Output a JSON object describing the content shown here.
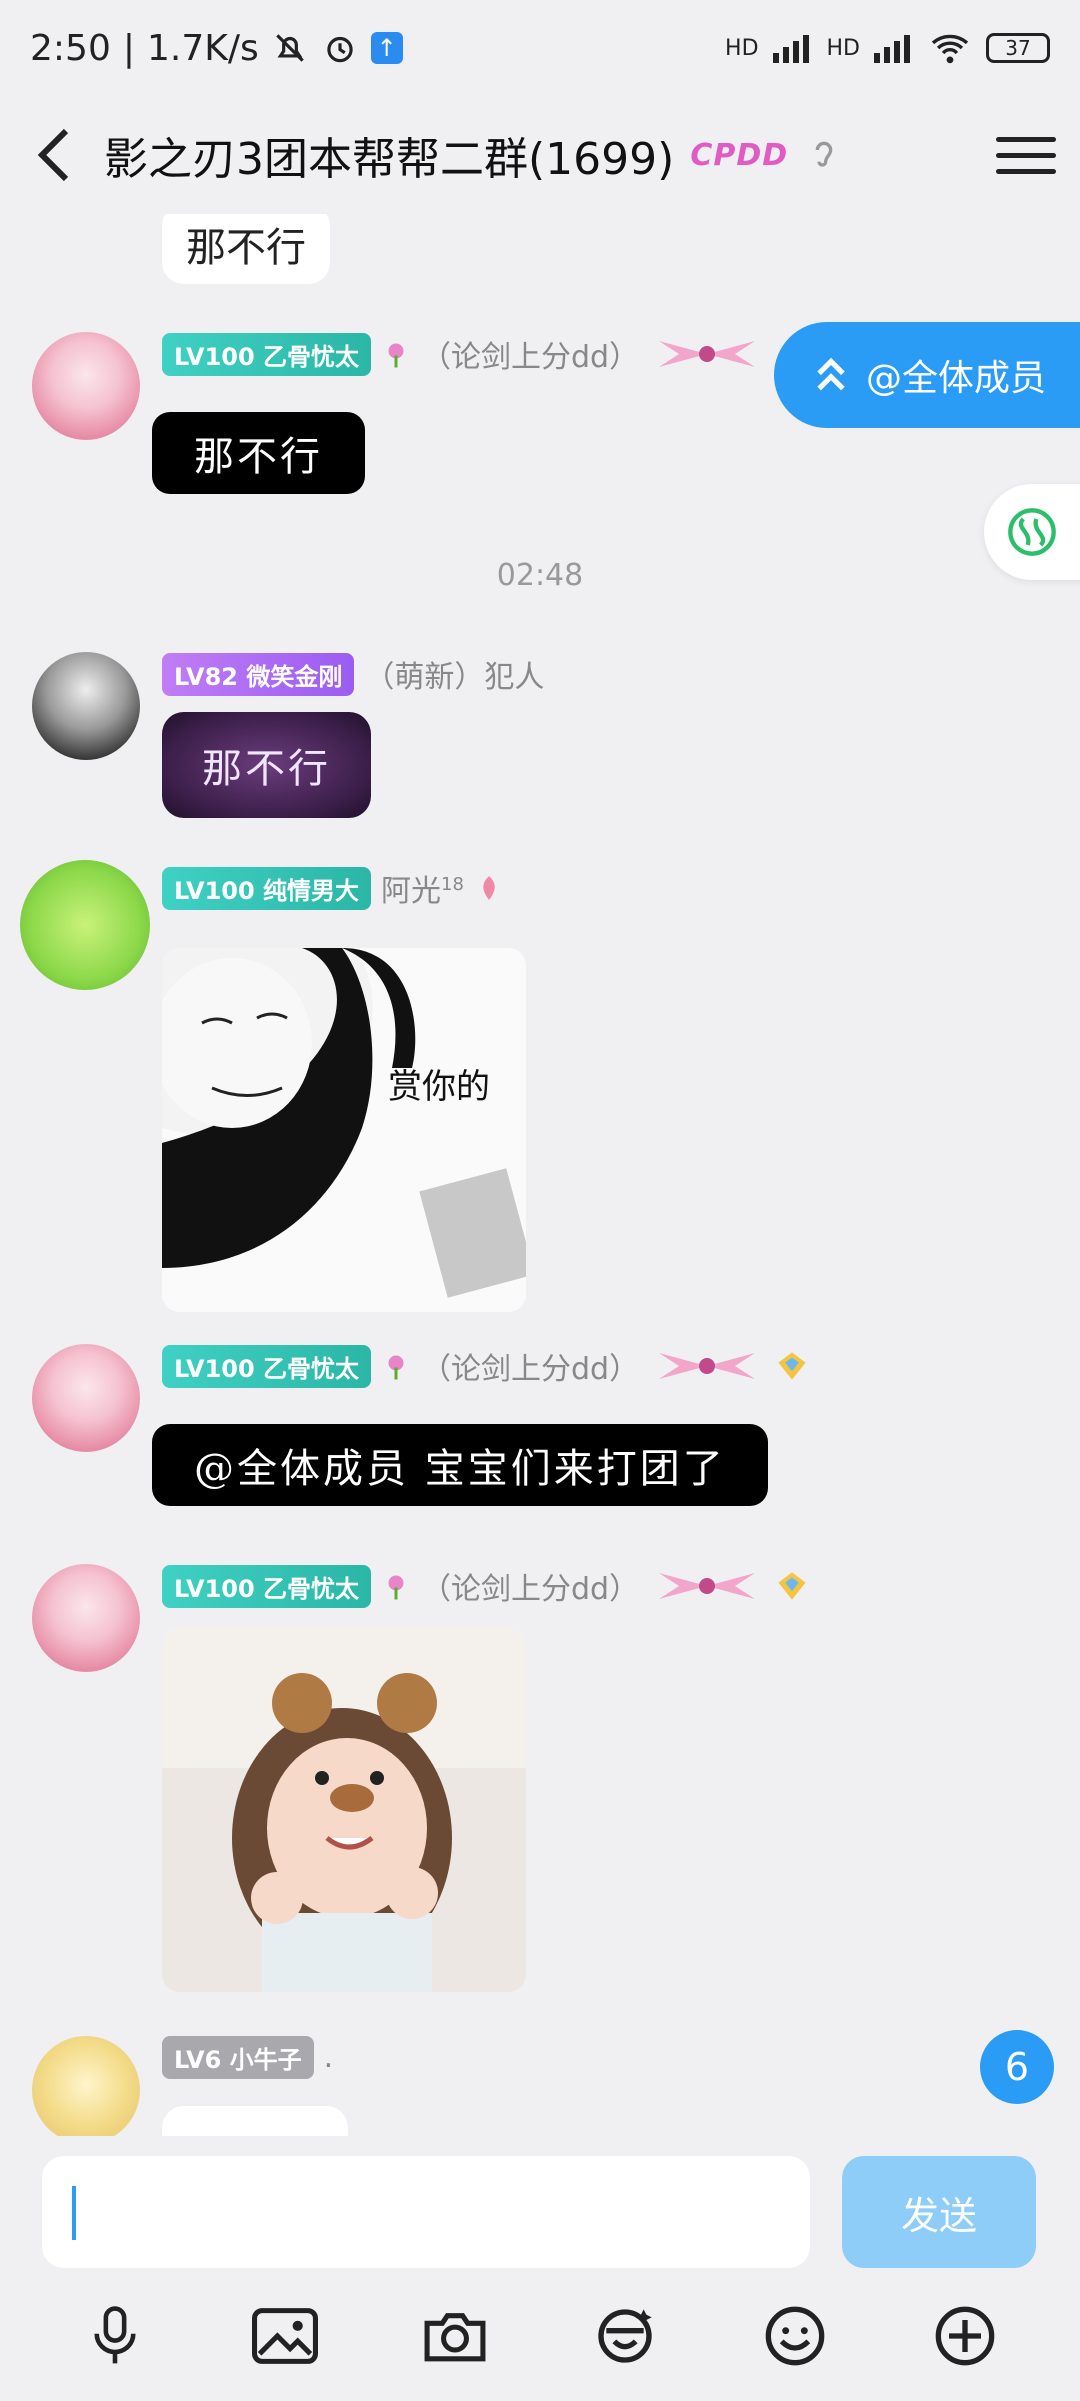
{
  "status_bar": {
    "time": "2:50",
    "speed": "1.7K/s",
    "battery": "37",
    "signal1": "HD",
    "signal2": "HD"
  },
  "header": {
    "title": "影之刃3团本帮帮二群(1699)",
    "badge": "CPDD"
  },
  "floating": {
    "at_all_label": "@全体成员",
    "unread_count": "6"
  },
  "messages": {
    "m0": {
      "text": "那不行"
    },
    "m1": {
      "level": "LV100 乙骨忧太",
      "name": "（论剑上分dd）",
      "text": "那不行"
    },
    "time1": "02:48",
    "m2": {
      "level": "LV82 微笑金刚",
      "name": "（萌新）犯人",
      "text": "那不行"
    },
    "m3": {
      "level": "LV100 纯情男大",
      "name": "阿光",
      "name_sup": "18",
      "image_caption": "赏你的"
    },
    "m4": {
      "level": "LV100 乙骨忧太",
      "name": "（论剑上分dd）",
      "text": "@全体成员 宝宝们来打团了"
    },
    "m5": {
      "level": "LV100 乙骨忧太",
      "name": "（论剑上分dd）"
    },
    "m6": {
      "level": "LV6 小牛子",
      "name": "."
    }
  },
  "input": {
    "value": "",
    "send_label": "发送"
  },
  "colors": {
    "accent": "#2a9cf5",
    "send_disabled": "#8dcdf8",
    "background": "#f0f0f3"
  }
}
